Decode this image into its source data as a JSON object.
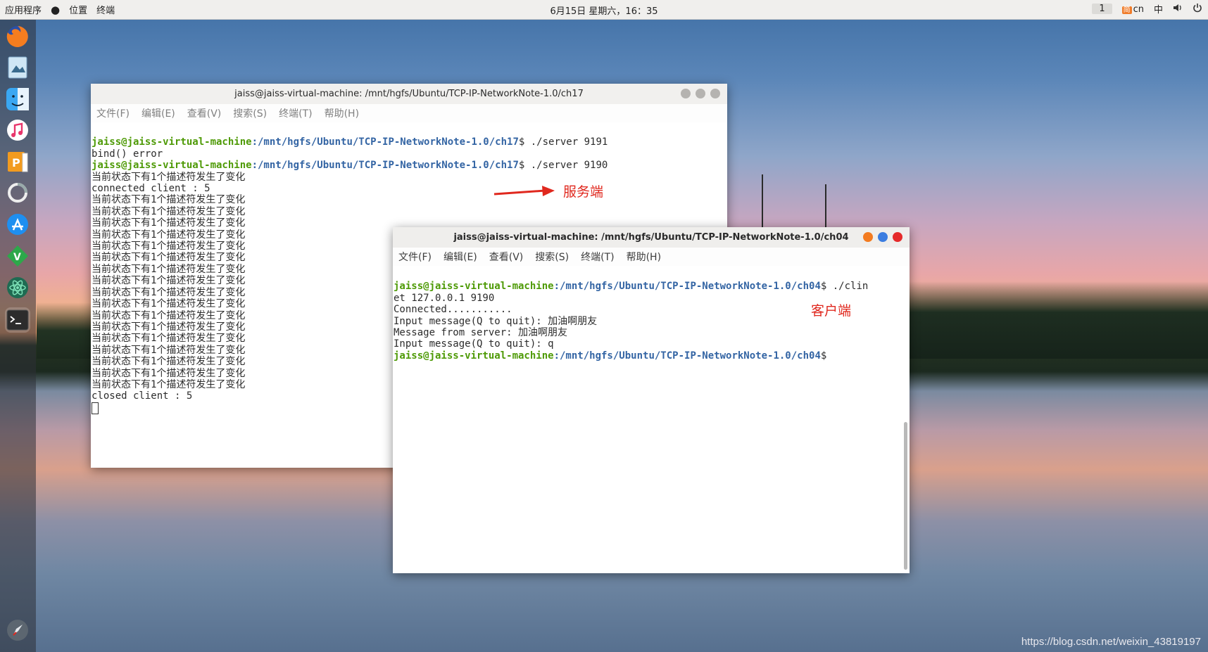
{
  "topbar": {
    "apps_label": "应用程序",
    "places_label": "位置",
    "terminal_label": "终端",
    "clock": "6月15日 星期六，16：35",
    "workspace": "1",
    "ime_badge": "简",
    "ime_lang": "cn",
    "input_mode": "中"
  },
  "dock": {
    "items": [
      "firefox",
      "photos",
      "finder",
      "music",
      "presentation",
      "update",
      "app-store",
      "vim",
      "atom",
      "terminal",
      "launchpad"
    ]
  },
  "server_window": {
    "title": "jaiss@jaiss-virtual-machine: /mnt/hgfs/Ubuntu/TCP-IP-NetworkNote-1.0/ch17",
    "menu": [
      "文件(F)",
      "编辑(E)",
      "查看(V)",
      "搜索(S)",
      "终端(T)",
      "帮助(H)"
    ],
    "prompt_user": "jaiss@jaiss-virtual-machine",
    "prompt_path": ":/mnt/hgfs/Ubuntu/TCP-IP-NetworkNote-1.0/ch17",
    "cmd1": "$ ./server 9191",
    "out1": "bind() error",
    "cmd2": "$ ./server 9190",
    "state_change": "当前状态下有1个描述符发生了变化",
    "connected": "connected client : 5",
    "closed": "closed client : 5"
  },
  "client_window": {
    "title": "jaiss@jaiss-virtual-machine: /mnt/hgfs/Ubuntu/TCP-IP-NetworkNote-1.0/ch04",
    "menu": [
      "文件(F)",
      "编辑(E)",
      "查看(V)",
      "搜索(S)",
      "终端(T)",
      "帮助(H)"
    ],
    "prompt_user": "jaiss@jaiss-virtual-machine",
    "prompt_path": ":/mnt/hgfs/Ubuntu/TCP-IP-NetworkNote-1.0/ch04",
    "cmd1": "$ ./clin",
    "cmd1_wrap": "et 127.0.0.1 9190",
    "out1": "Connected...........",
    "out2": "Input message(Q to quit): 加油啊朋友",
    "out3": "Message from server: 加油啊朋友",
    "out4": "Input message(Q to quit): q",
    "cmd2": "$"
  },
  "annotations": {
    "server_label": "服务端",
    "client_label": "客户端",
    "arrow_color": "#e0281e"
  },
  "watermark": "https://blog.csdn.net/weixin_43819197"
}
